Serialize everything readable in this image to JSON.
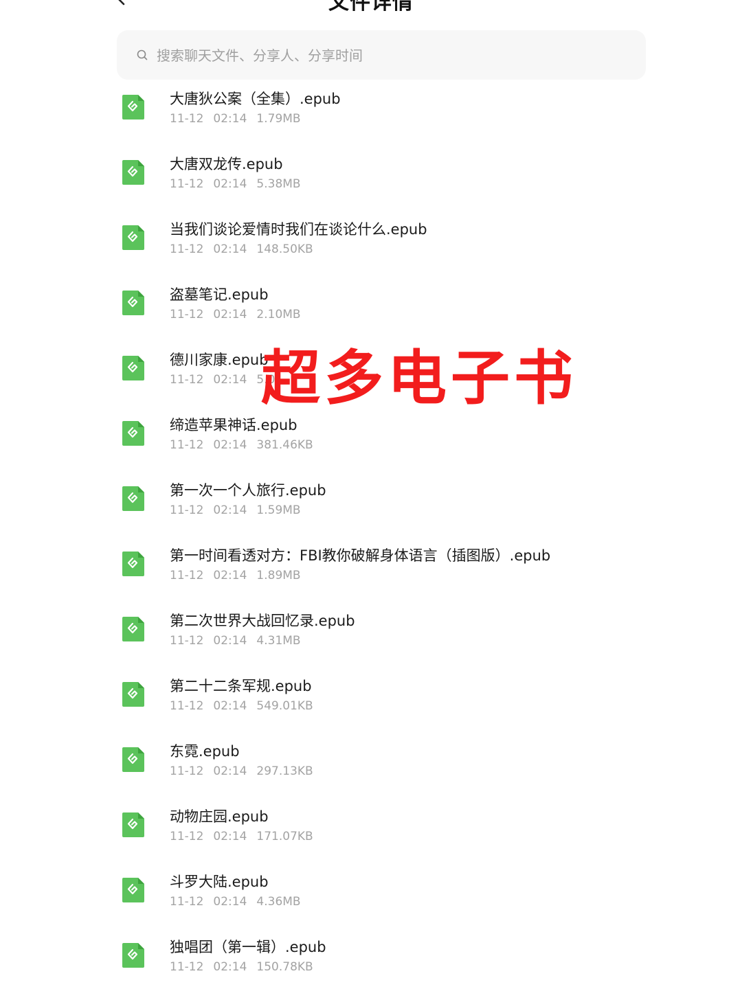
{
  "header": {
    "title": "文件详情"
  },
  "search": {
    "placeholder": "搜索聊天文件、分享人、分享时间",
    "value": ""
  },
  "files": [
    {
      "name": "大唐狄公案（全集）.epub",
      "date": "11-12",
      "time": "02:14",
      "size": "1.79MB"
    },
    {
      "name": "大唐双龙传.epub",
      "date": "11-12",
      "time": "02:14",
      "size": "5.38MB"
    },
    {
      "name": "当我们谈论爱情时我们在谈论什么.epub",
      "date": "11-12",
      "time": "02:14",
      "size": "148.50KB"
    },
    {
      "name": "盗墓笔记.epub",
      "date": "11-12",
      "time": "02:14",
      "size": "2.10MB"
    },
    {
      "name": "德川家康.epub",
      "date": "11-12",
      "time": "02:14",
      "size": "5.0"
    },
    {
      "name": "缔造苹果神话.epub",
      "date": "11-12",
      "time": "02:14",
      "size": "381.46KB"
    },
    {
      "name": "第一次一个人旅行.epub",
      "date": "11-12",
      "time": "02:14",
      "size": "1.59MB"
    },
    {
      "name": "第一时间看透对方：FBI教你破解身体语言（插图版）.epub",
      "date": "11-12",
      "time": "02:14",
      "size": "1.89MB"
    },
    {
      "name": "第二次世界大战回忆录.epub",
      "date": "11-12",
      "time": "02:14",
      "size": "4.31MB"
    },
    {
      "name": "第二十二条军规.epub",
      "date": "11-12",
      "time": "02:14",
      "size": "549.01KB"
    },
    {
      "name": "东霓.epub",
      "date": "11-12",
      "time": "02:14",
      "size": "297.13KB"
    },
    {
      "name": "动物庄园.epub",
      "date": "11-12",
      "time": "02:14",
      "size": "171.07KB"
    },
    {
      "name": "斗罗大陆.epub",
      "date": "11-12",
      "time": "02:14",
      "size": "4.36MB"
    },
    {
      "name": "独唱团（第一辑）.epub",
      "date": "11-12",
      "time": "02:14",
      "size": "150.78KB"
    }
  ],
  "overlay": {
    "text": "超多电子书"
  },
  "colors": {
    "icon_green": "#5bc35b",
    "overlay_red": "#f21d1d",
    "meta_gray": "#a3a3a3"
  },
  "icons": {
    "back": "chevron-left-icon",
    "search": "search-icon",
    "file": "epub-file-icon"
  }
}
